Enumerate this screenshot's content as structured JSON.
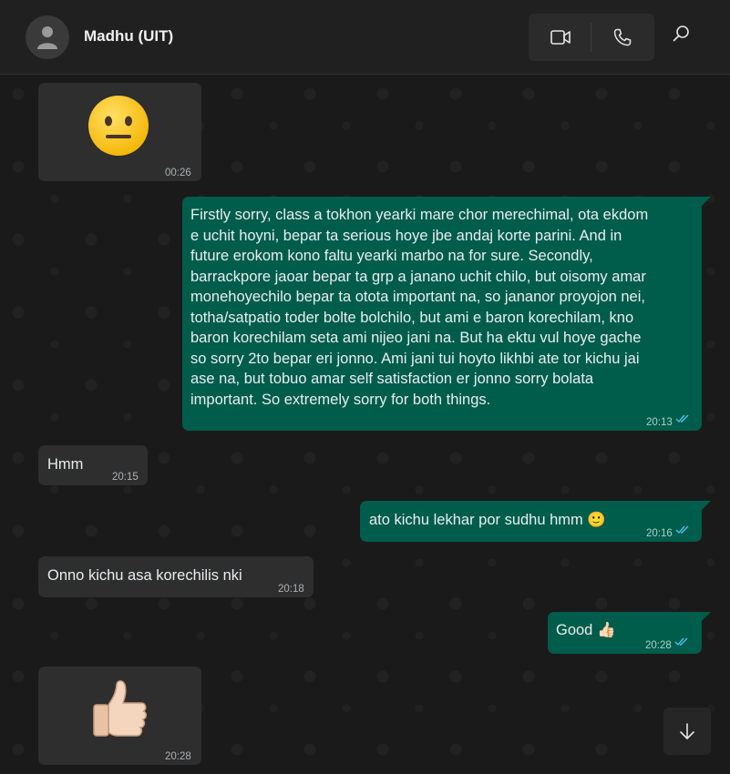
{
  "header": {
    "contact_name": "Madhu (UIT)",
    "icons": [
      "avatar-placeholder-icon",
      "video-call-icon",
      "voice-call-icon",
      "search-icon"
    ]
  },
  "messages": [
    {
      "dir": "in",
      "type": "sticker",
      "emoji": "neutral-face",
      "time": "00:26"
    },
    {
      "dir": "out",
      "type": "text",
      "lines": [
        "Firstly sorry, class a tokhon yearki mare chor merechimal, ota ekdom",
        "e uchit hoyni, bepar ta serious hoye jbe andaj korte parini. And in",
        "future erokom kono faltu yearki marbo na for sure. Secondly,",
        "barrackpore jaoar bepar ta grp a janano uchit chilo, but oisomy amar",
        "monehoyechilo bepar ta otota important na, so jananor proyojon nei,",
        "totha/satpatio toder bolte bolchilo, but ami e baron korechilam, kno",
        "baron korechilam seta ami nijeo jani na. But ha ektu vul hoye gache",
        "so sorry 2to bepar eri  jonno. Ami jani tui hoyto likhbi ate tor kichu jai",
        "ase na, but tobuo amar self satisfaction er jonno sorry bolata",
        "important. So extremely sorry for both things."
      ],
      "time": "20:13",
      "status": "read"
    },
    {
      "dir": "in",
      "type": "text",
      "text": "Hmm",
      "time": "20:15"
    },
    {
      "dir": "out",
      "type": "text",
      "text": "ato kichu lekhar por sudhu hmm 🙂",
      "time": "20:16",
      "status": "read"
    },
    {
      "dir": "in",
      "type": "text",
      "text": "Onno kichu asa korechilis nki",
      "time": "20:18"
    },
    {
      "dir": "out",
      "type": "text",
      "text": "Good 👍🏻",
      "time": "20:28",
      "status": "read"
    },
    {
      "dir": "in",
      "type": "sticker",
      "emoji": "thumbs-up",
      "time": "20:28"
    }
  ],
  "controls": {
    "scroll_down_icon": "arrow-down-icon"
  },
  "colors": {
    "outgoing_bubble": "#005c4b",
    "incoming_bubble": "#2e2e2e",
    "read_ticks": "#53bdeb",
    "background": "#1a1a1a"
  }
}
